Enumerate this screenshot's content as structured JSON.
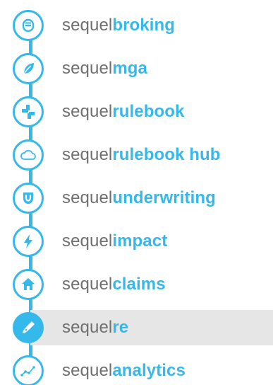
{
  "menu": {
    "accent_color": "#35b8ea",
    "active_background": "#e6e6e6",
    "prefix_color": "#6f6f6f",
    "items": [
      {
        "prefix": "sequel",
        "suffix": "broking",
        "icon": "broking-icon",
        "active": false
      },
      {
        "prefix": "sequel",
        "suffix": "mga",
        "icon": "leaf-icon",
        "active": false
      },
      {
        "prefix": "sequel",
        "suffix": "rulebook",
        "icon": "plus-blocks-icon",
        "active": false
      },
      {
        "prefix": "sequel",
        "suffix": "rulebook hub",
        "icon": "cloud-icon",
        "active": false
      },
      {
        "prefix": "sequel",
        "suffix": "underwriting",
        "icon": "shield-icon",
        "active": false
      },
      {
        "prefix": "sequel",
        "suffix": "impact",
        "icon": "lightning-icon",
        "active": false
      },
      {
        "prefix": "sequel",
        "suffix": "claims",
        "icon": "house-icon",
        "active": false
      },
      {
        "prefix": "sequel",
        "suffix": "re",
        "icon": "pen-nib-icon",
        "active": true
      },
      {
        "prefix": "sequel",
        "suffix": "analytics",
        "icon": "analytics-icon",
        "active": false
      }
    ]
  }
}
